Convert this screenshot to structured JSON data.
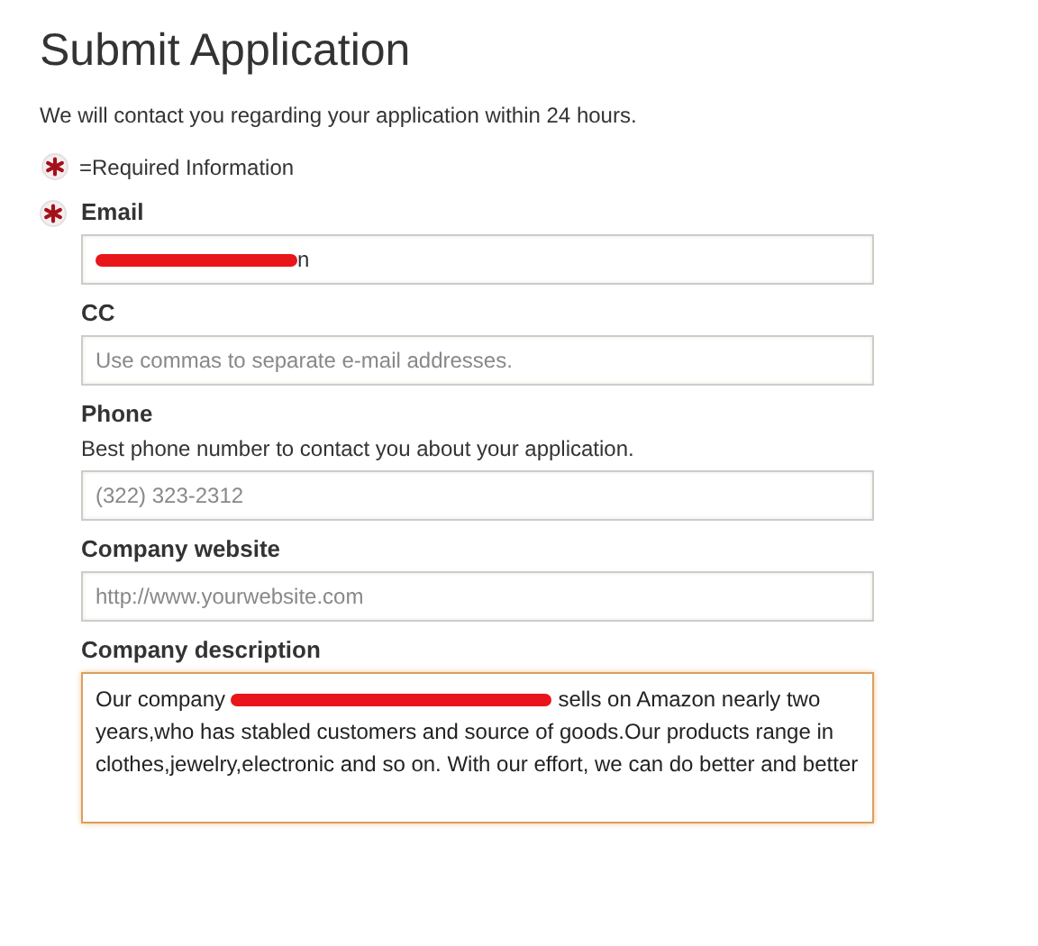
{
  "title": "Submit Application",
  "intro": "We will contact you regarding your application within 24 hours.",
  "required_note": "=Required Information",
  "fields": [
    {
      "label": "Email",
      "required": true,
      "kind": "input",
      "focused": false,
      "value_parts": [
        {
          "kind": "redaction"
        },
        {
          "kind": "text",
          "text": "n"
        }
      ]
    },
    {
      "label": "CC",
      "required": false,
      "kind": "input",
      "focused": false,
      "placeholder": "Use commas to separate e-mail addresses."
    },
    {
      "label": "Phone",
      "required": false,
      "kind": "input",
      "focused": false,
      "hint": "Best phone number to contact you about your application.",
      "placeholder": "(322) 323-2312"
    },
    {
      "label": "Company website",
      "required": false,
      "kind": "input",
      "focused": false,
      "placeholder": "http://www.yourwebsite.com"
    },
    {
      "label": "Company description",
      "required": false,
      "kind": "textarea",
      "focused": true,
      "value_parts": [
        {
          "kind": "text",
          "text": "Our company "
        },
        {
          "kind": "redaction"
        },
        {
          "kind": "text",
          "text": " sells on Amazon nearly two years,who has stabled customers and source of goods.Our products range in clothes,jewelry,electronic and so on. With our effort, we can do better and better"
        }
      ]
    }
  ]
}
